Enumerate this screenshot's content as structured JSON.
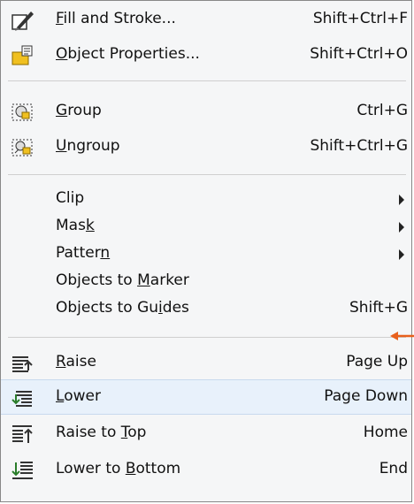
{
  "menu": {
    "items": [
      {
        "pre": "",
        "u": "F",
        "post": "ill and Stroke...",
        "shortcut": "Shift+Ctrl+F",
        "icon": "fill-stroke-icon"
      },
      {
        "pre": "",
        "u": "O",
        "post": "bject Properties...",
        "shortcut": "Shift+Ctrl+O",
        "icon": "object-properties-icon"
      },
      {
        "pre": "",
        "u": "G",
        "post": "roup",
        "shortcut": "Ctrl+G",
        "icon": "group-icon"
      },
      {
        "pre": "",
        "u": "U",
        "post": "ngroup",
        "shortcut": "Shift+Ctrl+G",
        "icon": "ungroup-icon"
      },
      {
        "pre": "Clip",
        "u": "",
        "post": "",
        "shortcut": "",
        "icon": ""
      },
      {
        "pre": "Mas",
        "u": "k",
        "post": "",
        "shortcut": "",
        "icon": ""
      },
      {
        "pre": "Patter",
        "u": "n",
        "post": "",
        "shortcut": "",
        "icon": ""
      },
      {
        "pre": "Objects to ",
        "u": "M",
        "post": "arker",
        "shortcut": "",
        "icon": ""
      },
      {
        "pre": "Objects to Gu",
        "u": "i",
        "post": "des",
        "shortcut": "Shift+G",
        "icon": ""
      },
      {
        "pre": "",
        "u": "R",
        "post": "aise",
        "shortcut": "Page Up",
        "icon": "raise-icon"
      },
      {
        "pre": "",
        "u": "L",
        "post": "ower",
        "shortcut": "Page Down",
        "icon": "lower-icon"
      },
      {
        "pre": "Raise to ",
        "u": "T",
        "post": "op",
        "shortcut": "Home",
        "icon": "raise-to-top-icon"
      },
      {
        "pre": "Lower to ",
        "u": "B",
        "post": "ottom",
        "shortcut": "End",
        "icon": "lower-to-bottom-icon"
      }
    ]
  },
  "colors": {
    "highlight": "#e8f1fb",
    "pointer": "#e8601c"
  }
}
